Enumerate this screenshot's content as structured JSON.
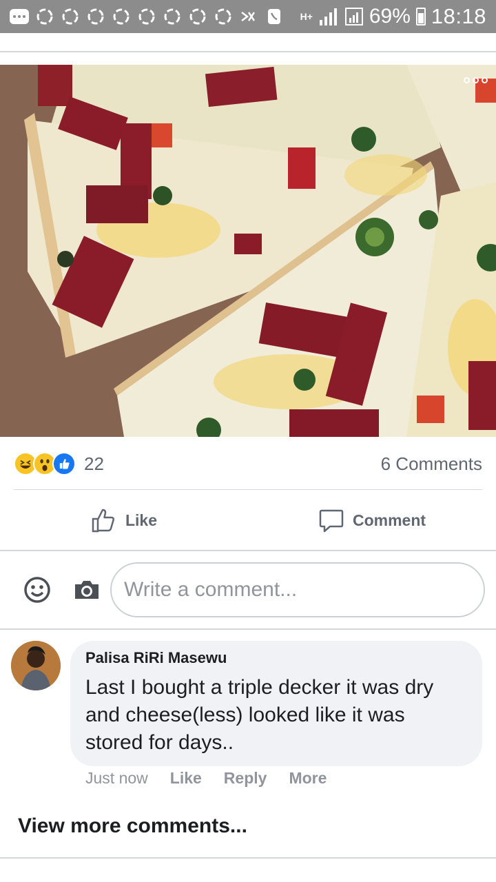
{
  "status_bar": {
    "network": "H+",
    "battery": "69%",
    "time": "18:18"
  },
  "post": {
    "photo_icon": "more-options-icon",
    "reactions": {
      "icons": [
        "haha-reaction-icon",
        "wow-reaction-icon",
        "like-reaction-icon"
      ],
      "count": "22"
    },
    "comments_count": "6 Comments",
    "actions": {
      "like_label": "Like",
      "comment_label": "Comment"
    }
  },
  "composer": {
    "placeholder": "Write a comment..."
  },
  "comment": {
    "author": "Palisa RiRi Masewu",
    "text": "Last I bought a triple decker it was dry and cheese(less) looked like it was stored for days..",
    "time": "Just now",
    "like_label": "Like",
    "reply_label": "Reply",
    "more_label": "More"
  },
  "view_more": "View more comments...",
  "colors": {
    "status_bar_bg": "#8c8c8c",
    "like_blue": "#1877f2",
    "bubble_bg": "#f0f2f5",
    "secondary_text": "#606770"
  }
}
